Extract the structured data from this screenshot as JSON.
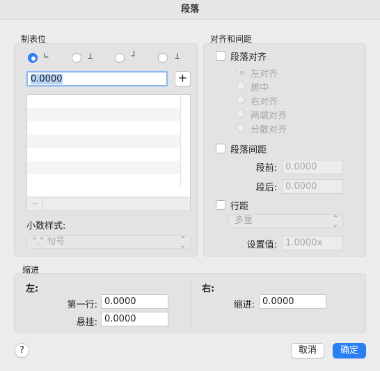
{
  "window": {
    "title": "段落"
  },
  "tabs_section": {
    "label": "制表位",
    "alignments": [
      {
        "icon": "left-tab-icon",
        "glyph": "∟",
        "selected": true
      },
      {
        "icon": "center-tab-icon",
        "glyph": "⊥",
        "selected": false
      },
      {
        "icon": "right-tab-icon",
        "glyph": "┘",
        "selected": false
      },
      {
        "icon": "decimal-tab-icon",
        "glyph": "⊥",
        "selected": false
      }
    ],
    "position_value": "0.0000",
    "add_symbol": "+",
    "remove_symbol": "—",
    "list_rows": [
      "",
      "",
      "",
      "",
      "",
      "",
      ""
    ],
    "decimal_style_label": "小数样式:",
    "decimal_style_value": "\".\" 句号"
  },
  "alignment_section": {
    "label": "对齐和间距",
    "paragraph_align_label": "段落对齐",
    "options": [
      {
        "label": "左对齐",
        "selected": true
      },
      {
        "label": "居中",
        "selected": false
      },
      {
        "label": "右对齐",
        "selected": false
      },
      {
        "label": "两端对齐",
        "selected": false
      },
      {
        "label": "分散对齐",
        "selected": false
      }
    ],
    "spacing_label": "段落间距",
    "before_label": "段前:",
    "before_value": "0.0000",
    "after_label": "段后:",
    "after_value": "0.0000",
    "line_spacing_label": "行距",
    "line_spacing_value": "多重",
    "set_value_label": "设置值:",
    "set_value": "1.0000x"
  },
  "indent_section": {
    "label": "缩进",
    "left_label": "左:",
    "first_line_label": "第一行:",
    "first_line_value": "0.0000",
    "hanging_label": "悬挂:",
    "hanging_value": "0.0000",
    "right_label": "右:",
    "right_indent_label": "缩进:",
    "right_indent_value": "0.0000"
  },
  "footer": {
    "help_label": "?",
    "cancel_label": "取消",
    "ok_label": "确定"
  },
  "colors": {
    "accent": "#2a7ff3",
    "background": "#ececec",
    "panel": "#e3e3e3"
  }
}
